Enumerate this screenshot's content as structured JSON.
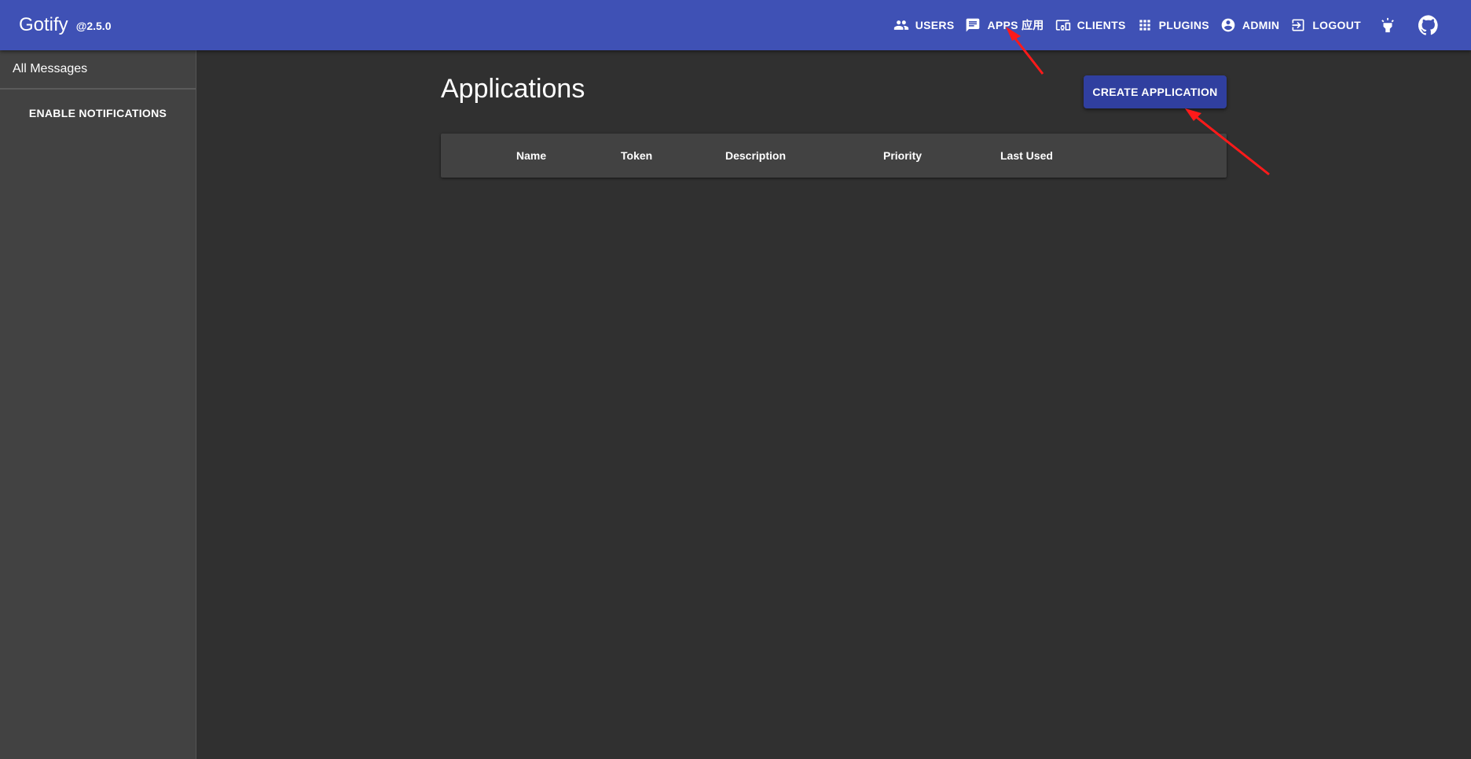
{
  "appbar": {
    "title": "Gotify",
    "version": "@2.5.0",
    "nav": {
      "users": "USERS",
      "apps": "APPS 应用",
      "clients": "CLIENTS",
      "plugins": "PLUGINS",
      "admin": "ADMIN",
      "logout": "LOGOUT"
    }
  },
  "sidebar": {
    "all_messages": "All Messages",
    "enable_notifications": "ENABLE NOTIFICATIONS"
  },
  "main": {
    "title": "Applications",
    "create_button": "CREATE APPLICATION",
    "table": {
      "columns": [
        "Name",
        "Token",
        "Description",
        "Priority",
        "Last Used"
      ]
    }
  },
  "annotations": {
    "arrow_color": "#ff1a1a"
  },
  "colors": {
    "appbar": "#3f51b5",
    "primary_button": "#303f9f",
    "background": "#303030",
    "sidebar": "#424242"
  }
}
